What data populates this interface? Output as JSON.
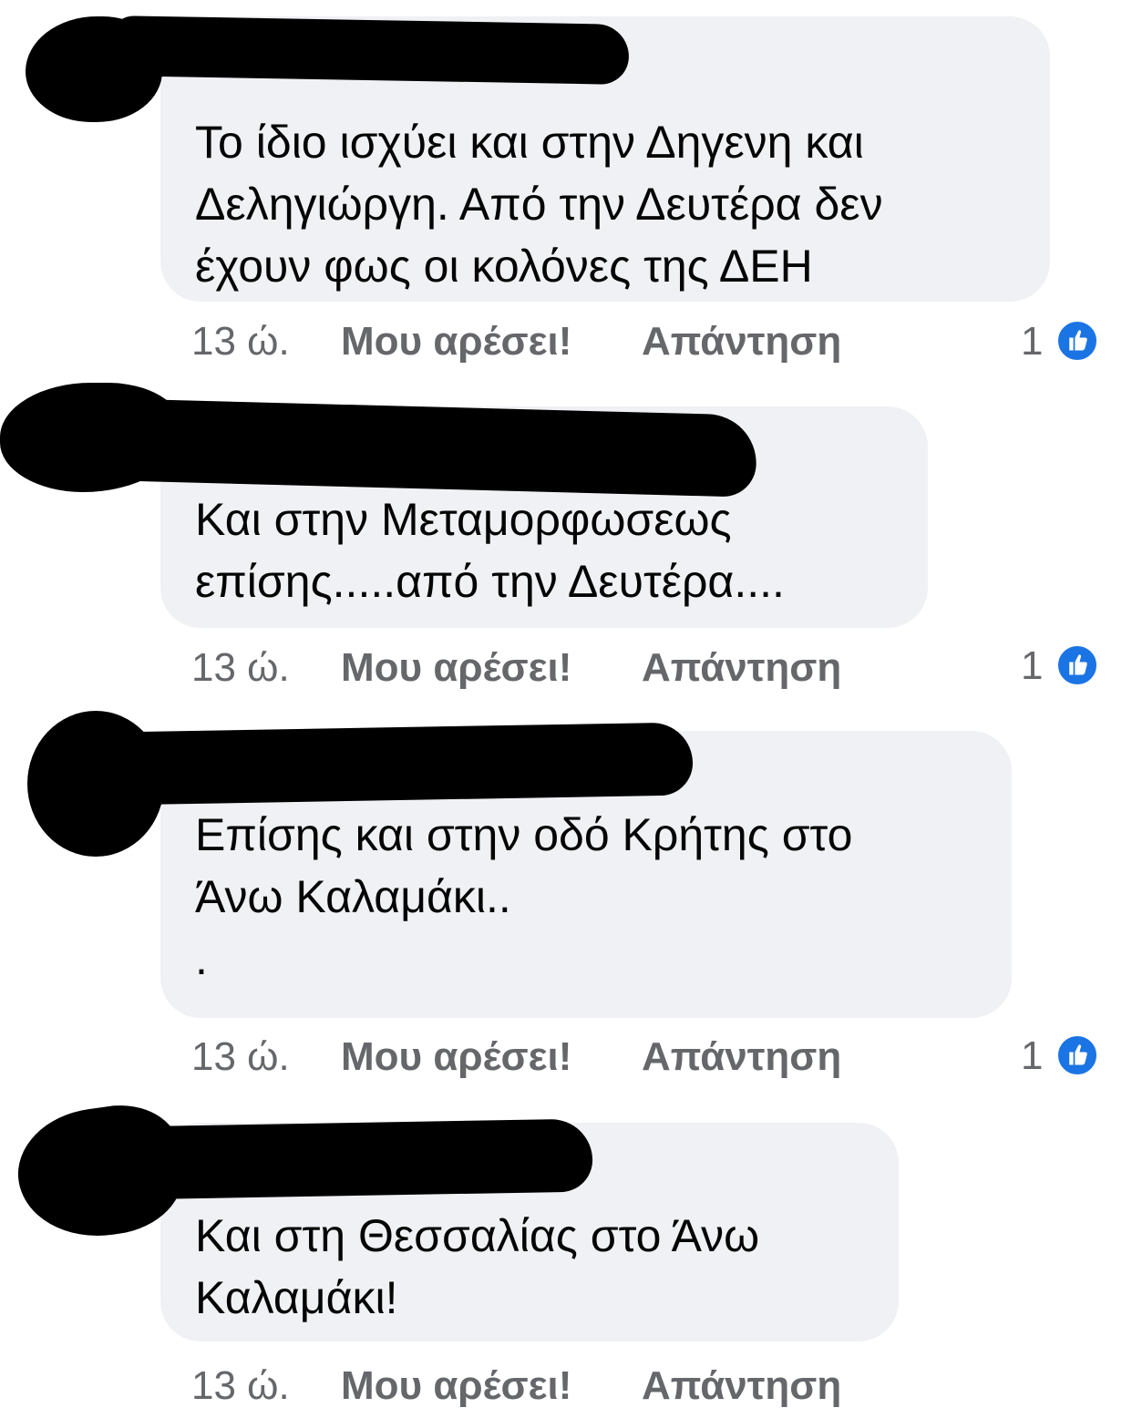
{
  "comments": [
    {
      "author": "",
      "text": "Το ίδιο ισχύει και στην Δηγενη και\nΔεληγιώργη. Από την Δευτέρα δεν\nέχουν φως οι κολόνες της ΔΕΗ",
      "time": "13 ώ.",
      "like_label": "Μου αρέσει!",
      "reply_label": "Απάντηση",
      "reaction_count": "1",
      "reaction_icon": "thumbs-up-icon"
    },
    {
      "author": "",
      "text": "Και στην Μεταμορφωσεως\nεπίσης.....από την Δευτέρα....",
      "time": "13 ώ.",
      "like_label": "Μου αρέσει!",
      "reply_label": "Απάντηση",
      "reaction_count": "1",
      "reaction_icon": "thumbs-up-icon"
    },
    {
      "author": "",
      "text": "Επίσης και στην οδό Κρήτης στο\nΆνω Καλαμάκι..\n.",
      "time": "13 ώ.",
      "like_label": "Μου αρέσει!",
      "reply_label": "Απάντηση",
      "reaction_count": "1",
      "reaction_icon": "thumbs-up-icon"
    },
    {
      "author": "",
      "text": "Και στη Θεσσαλίας στο Άνω\nΚαλαμάκι!",
      "time": "13 ώ.",
      "like_label": "Μου αρέσει!",
      "reply_label": "Απάντηση"
    }
  ],
  "colors": {
    "bubble_bg": "#f0f1f4",
    "meta_text": "#65676b",
    "like_blue": "#1b74e4",
    "redaction": "#000000"
  }
}
